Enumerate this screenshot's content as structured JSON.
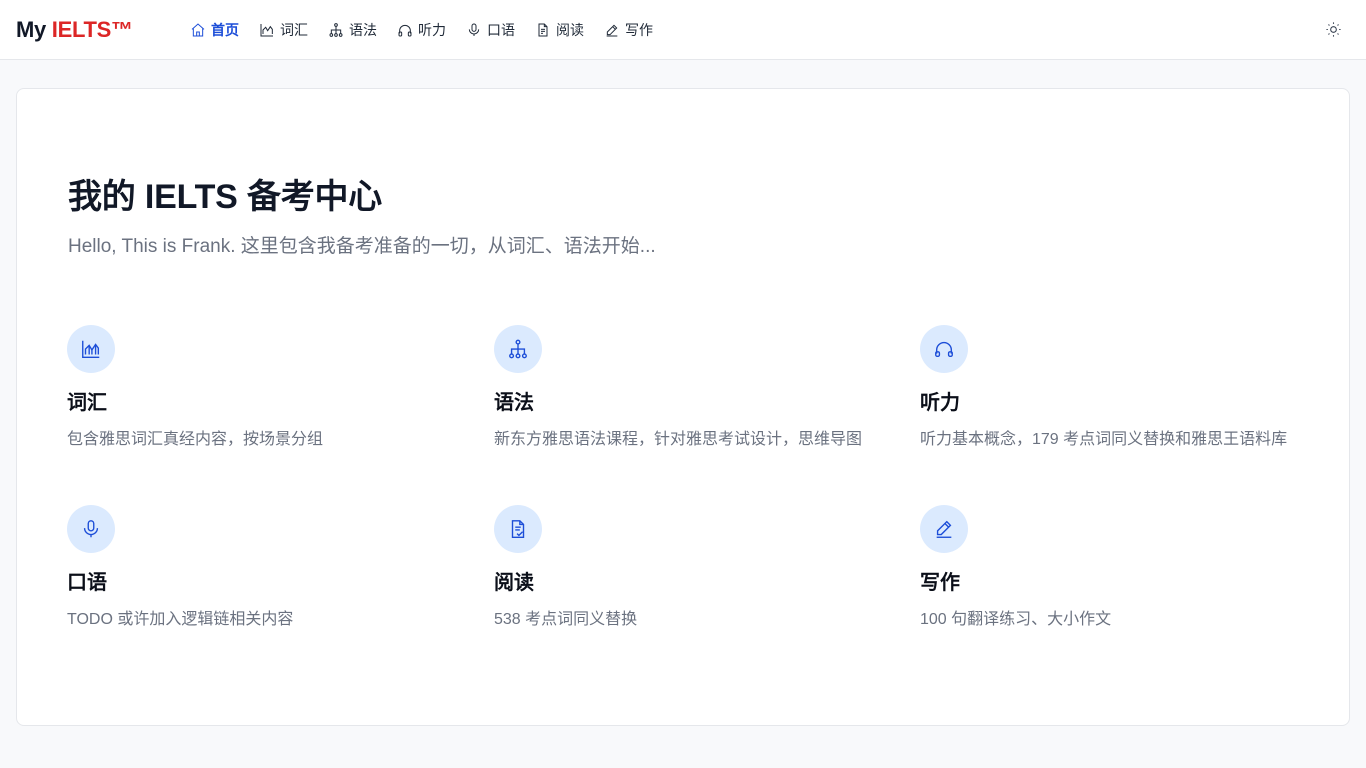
{
  "brand": {
    "prefix": "My ",
    "accent": "IELTS™"
  },
  "nav": {
    "items": [
      {
        "label": "首页",
        "icon": "home-icon",
        "active": true
      },
      {
        "label": "词汇",
        "icon": "chart-icon",
        "active": false
      },
      {
        "label": "语法",
        "icon": "hierarchy-icon",
        "active": false
      },
      {
        "label": "听力",
        "icon": "headphones-icon",
        "active": false
      },
      {
        "label": "口语",
        "icon": "microphone-icon",
        "active": false
      },
      {
        "label": "阅读",
        "icon": "document-icon",
        "active": false
      },
      {
        "label": "写作",
        "icon": "pencil-icon",
        "active": false
      }
    ],
    "theme_icon": "sun-icon"
  },
  "hero": {
    "title": "我的 IELTS 备考中心",
    "subtitle": "Hello, This is Frank. 这里包含我备考准备的一切，从词汇、语法开始..."
  },
  "features": [
    {
      "title": "词汇",
      "desc": "包含雅思词汇真经内容，按场景分组",
      "icon": "chart-icon"
    },
    {
      "title": "语法",
      "desc": "新东方雅思语法课程，针对雅思考试设计，思维导图",
      "icon": "hierarchy-icon"
    },
    {
      "title": "听力",
      "desc": "听力基本概念，179 考点词同义替换和雅思王语料库",
      "icon": "headphones-icon"
    },
    {
      "title": "口语",
      "desc": "TODO 或许加入逻辑链相关内容",
      "icon": "microphone-icon"
    },
    {
      "title": "阅读",
      "desc": "538 考点词同义替换",
      "icon": "document-icon"
    },
    {
      "title": "写作",
      "desc": "100 句翻译练习、大小作文",
      "icon": "pencil-icon"
    }
  ],
  "colors": {
    "accent": "#1d4ed8",
    "brand_red": "#dc2626",
    "icon_bg": "#dbeafe",
    "page_bg": "#f8f9fb"
  }
}
